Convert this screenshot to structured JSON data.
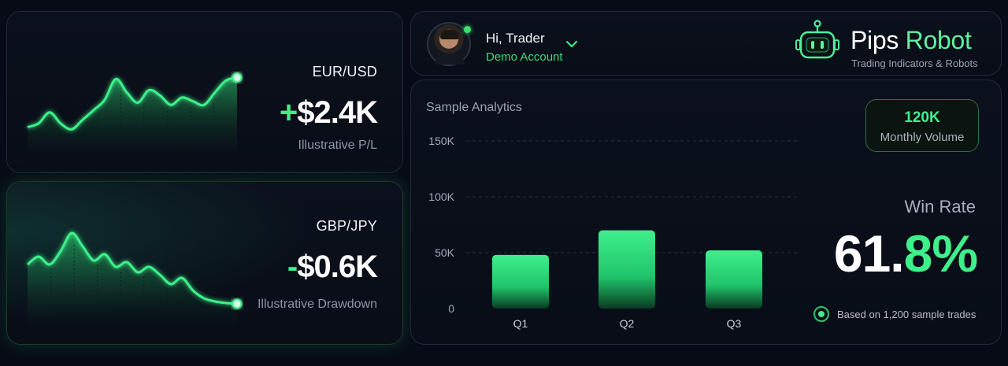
{
  "pairs": [
    {
      "name": "EUR/USD",
      "sign": "+",
      "amount": "$2.4K",
      "subtitle": "Illustrative P/L",
      "sparkline": [
        0.25,
        0.3,
        0.45,
        0.3,
        0.22,
        0.35,
        0.48,
        0.62,
        0.9,
        0.72,
        0.58,
        0.75,
        0.68,
        0.55,
        0.65,
        0.6,
        0.55,
        0.72,
        0.88,
        0.92
      ]
    },
    {
      "name": "GBP/JPY",
      "sign": "-",
      "amount": "$0.6K",
      "subtitle": "Illustrative Drawdown",
      "sparkline": [
        0.55,
        0.65,
        0.55,
        0.72,
        0.95,
        0.78,
        0.6,
        0.68,
        0.52,
        0.58,
        0.45,
        0.52,
        0.42,
        0.3,
        0.38,
        0.22,
        0.12,
        0.08,
        0.06,
        0.05
      ]
    }
  ],
  "header": {
    "greeting": "Hi, Trader",
    "account": "Demo Account",
    "brand_primary": "Pips ",
    "brand_secondary": "Robot",
    "tagline": "Trading Indicators & Robots"
  },
  "analytics": {
    "title": "Sample Analytics",
    "volume_value": "120K",
    "volume_label": "Monthly Volume",
    "win_rate_label": "Win Rate",
    "win_rate_int": "61.",
    "win_rate_dec": "8%",
    "footnote": "Based on 1,200 sample trades"
  },
  "colors": {
    "accent": "#3ef08a",
    "background": "#070b15",
    "muted": "#9aa3ae"
  },
  "chart_data": {
    "type": "bar",
    "categories": [
      "Q1",
      "Q2",
      "Q3"
    ],
    "values": [
      48000,
      70000,
      52000
    ],
    "ylim": [
      0,
      150000
    ],
    "yticks": [
      "0",
      "50K",
      "100K",
      "150K"
    ],
    "ytick_values": [
      0,
      50000,
      100000,
      150000
    ],
    "grid": true
  }
}
